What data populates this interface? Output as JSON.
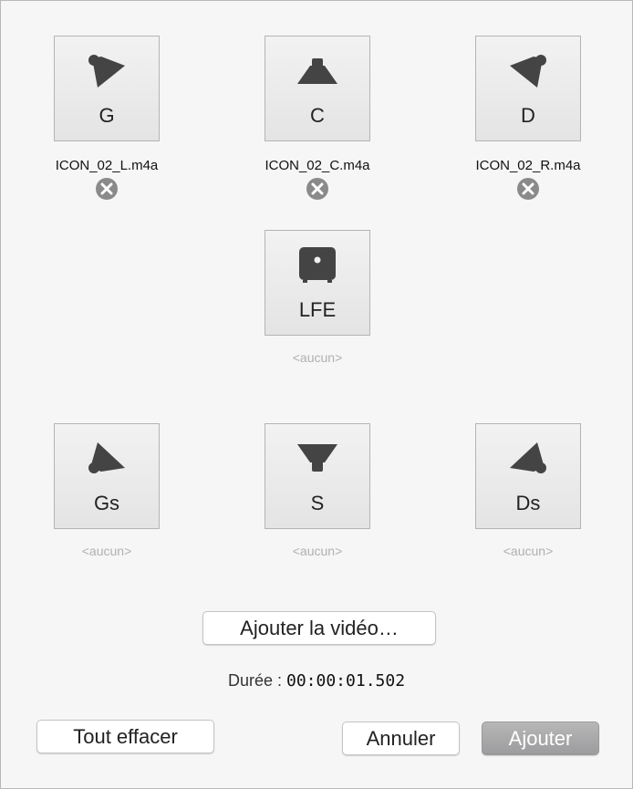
{
  "channels": {
    "left": {
      "code": "G",
      "file": "ICON_02_L.m4a",
      "icon": "speaker-front-left-icon"
    },
    "center": {
      "code": "C",
      "file": "ICON_02_C.m4a",
      "icon": "speaker-center-icon"
    },
    "right": {
      "code": "D",
      "file": "ICON_02_R.m4a",
      "icon": "speaker-front-right-icon"
    },
    "lfe": {
      "code": "LFE",
      "file": "<aucun>",
      "icon": "subwoofer-icon"
    },
    "left_surround": {
      "code": "Gs",
      "file": "<aucun>",
      "icon": "speaker-rear-left-icon"
    },
    "surround": {
      "code": "S",
      "file": "<aucun>",
      "icon": "speaker-rear-center-icon"
    },
    "right_surround": {
      "code": "Ds",
      "file": "<aucun>",
      "icon": "speaker-rear-right-icon"
    }
  },
  "remove_icon": "remove-circle-icon",
  "buttons": {
    "add_video": "Ajouter la vidéo…",
    "clear_all": "Tout effacer",
    "cancel": "Annuler",
    "add": "Ajouter"
  },
  "duration": {
    "label": "Durée :",
    "value": "00:00:01.502"
  },
  "colors": {
    "glyph": "#444444",
    "placeholder": "#b0b0b0",
    "primary_button": "#a8a8aa"
  }
}
